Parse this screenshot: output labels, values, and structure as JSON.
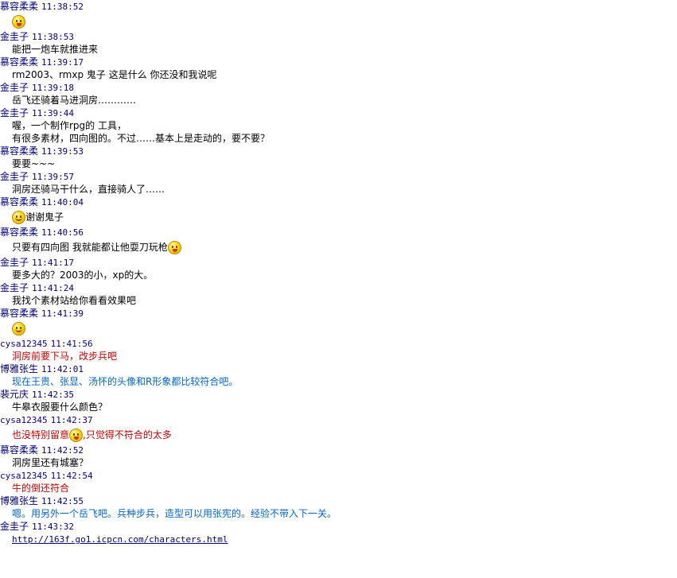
{
  "colors": {
    "name_primary": "#000080",
    "name_cy": "#000099",
    "red_text": "#cc0000",
    "blue_text": "#0066cc"
  },
  "messages": [
    {
      "sender": "慕容柔柔",
      "time": "11:38:52",
      "lines": [
        [
          {
            "type": "emoji",
            "icon": "wink-emoji-icon"
          }
        ]
      ]
    },
    {
      "sender": "金圭子",
      "time": "11:38:53",
      "lines": [
        [
          {
            "type": "text",
            "text": "能把一炮车就推进来"
          }
        ]
      ]
    },
    {
      "sender": "慕容柔柔",
      "time": "11:39:17",
      "lines": [
        [
          {
            "type": "text",
            "text": "rm2003、rmxp  鬼子 这是什么 你还没和我说呢"
          }
        ]
      ]
    },
    {
      "sender": "金圭子",
      "time": "11:39:18",
      "lines": [
        [
          {
            "type": "text",
            "text": "岳飞还骑着马进洞房…………"
          }
        ]
      ]
    },
    {
      "sender": "金圭子",
      "time": "11:39:44",
      "lines": [
        [
          {
            "type": "text",
            "text": "喔，一个制作rpg的 工具，"
          }
        ],
        [
          {
            "type": "text",
            "text": "有很多素材，四向图的。不过……基本上是走动的，要不要？"
          }
        ]
      ]
    },
    {
      "sender": "慕容柔柔",
      "time": "11:39:53",
      "lines": [
        [
          {
            "type": "text",
            "text": "要要~~~"
          }
        ]
      ]
    },
    {
      "sender": "金圭子",
      "time": "11:39:57",
      "lines": [
        [
          {
            "type": "text",
            "text": "洞房还骑马干什么，直接骑人了……"
          }
        ]
      ]
    },
    {
      "sender": "慕容柔柔",
      "time": "11:40:04",
      "lines": [
        [
          {
            "type": "emoji",
            "icon": "smile-emoji-icon"
          },
          {
            "type": "text",
            "text": "谢谢鬼子"
          }
        ]
      ]
    },
    {
      "sender": "慕容柔柔",
      "time": "11:40:56",
      "lines": [
        [
          {
            "type": "text",
            "text": "只要有四向图 我就能都让他耍刀玩枪"
          },
          {
            "type": "emoji",
            "icon": "tongue-emoji-icon"
          }
        ]
      ]
    },
    {
      "sender": "金圭子",
      "time": "11:41:17",
      "lines": [
        [
          {
            "type": "text",
            "text": "要多大的？2003的小，xp的大。"
          }
        ]
      ]
    },
    {
      "sender": "金圭子",
      "time": "11:41:24",
      "lines": [
        [
          {
            "type": "text",
            "text": "我找个素材站给你看看效果吧"
          }
        ]
      ]
    },
    {
      "sender": "慕容柔柔",
      "time": "11:41:39",
      "lines": [
        [
          {
            "type": "emoji",
            "icon": "smile-emoji-icon"
          }
        ]
      ]
    },
    {
      "sender": "cysa12345",
      "time": "11:41:56",
      "sender_style": "cy",
      "text_style": "red",
      "lines": [
        [
          {
            "type": "text",
            "text": "洞房前要下马，改步兵吧"
          }
        ]
      ]
    },
    {
      "sender": "博雅张生",
      "time": "11:42:01",
      "text_style": "blue",
      "lines": [
        [
          {
            "type": "text",
            "text": "现在王贵、张显、汤怀的头像和R形象都比较符合吧。"
          }
        ]
      ]
    },
    {
      "sender": "裴元庆",
      "time": "11:42:35",
      "lines": [
        [
          {
            "type": "text",
            "text": "牛皋衣服要什么颜色？"
          }
        ]
      ]
    },
    {
      "sender": "cysa12345",
      "time": "11:42:37",
      "sender_style": "cy",
      "text_style": "red",
      "lines": [
        [
          {
            "type": "text",
            "text": "也没特别留意"
          },
          {
            "type": "emoji",
            "icon": "wink-emoji-icon"
          },
          {
            "type": "text",
            "text": ",只觉得不符合的太多"
          }
        ]
      ]
    },
    {
      "sender": "慕容柔柔",
      "time": "11:42:52",
      "lines": [
        [
          {
            "type": "text",
            "text": "洞房里还有城塞？"
          }
        ]
      ]
    },
    {
      "sender": "cysa12345",
      "time": "11:42:54",
      "sender_style": "cy",
      "text_style": "red",
      "lines": [
        [
          {
            "type": "text",
            "text": "牛的倒还符合"
          }
        ]
      ]
    },
    {
      "sender": "博雅张生",
      "time": "11:42:55",
      "text_style": "blue",
      "lines": [
        [
          {
            "type": "text",
            "text": "嗯。用另外一个岳飞吧。兵种步兵，造型可以用张宪的。经验不带入下一关。"
          }
        ]
      ]
    },
    {
      "sender": "金圭子",
      "time": "11:43:32",
      "lines": [
        [
          {
            "type": "link",
            "text": "http://163f.go1.icpcn.com/characters.html"
          }
        ]
      ]
    }
  ]
}
